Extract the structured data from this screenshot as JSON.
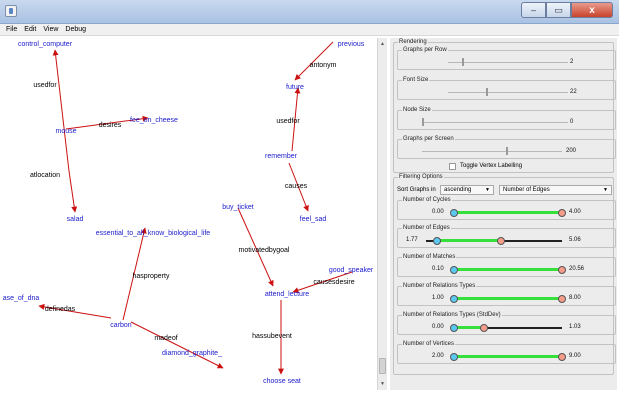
{
  "window": {
    "controls": [
      "–",
      "▭",
      "x"
    ]
  },
  "menu": [
    "File",
    "Edit",
    "View",
    "Debug"
  ],
  "graph": {
    "vertices": [
      {
        "id": "control_computer",
        "label": "control_computer"
      },
      {
        "id": "mouse",
        "label": "mouse"
      },
      {
        "id": "fee_on_cheese",
        "label": "fee_on_cheese"
      },
      {
        "id": "salad",
        "label": "salad"
      },
      {
        "id": "previous",
        "label": "previous"
      },
      {
        "id": "future",
        "label": "future"
      },
      {
        "id": "remember",
        "label": "remember"
      },
      {
        "id": "feel_sad",
        "label": "feel_sad"
      },
      {
        "id": "buy_ticket",
        "label": "buy_ticket"
      },
      {
        "id": "essential",
        "label": "essential_to_all_know_biological_life"
      },
      {
        "id": "good_speaker",
        "label": "good_speaker"
      },
      {
        "id": "attend_lecture",
        "label": "attend_lecture"
      },
      {
        "id": "ase_of_dna",
        "label": "ase_of_dna"
      },
      {
        "id": "carbon",
        "label": "carbon"
      },
      {
        "id": "diamond",
        "label": "diamond_graphite_"
      },
      {
        "id": "choose_seat",
        "label": "choose seat"
      }
    ],
    "edge_labels": [
      {
        "id": "usedfor1",
        "label": "usedfor"
      },
      {
        "id": "desires",
        "label": "desires"
      },
      {
        "id": "atlocation",
        "label": "atlocation"
      },
      {
        "id": "antonym",
        "label": "antonym"
      },
      {
        "id": "usedfor2",
        "label": "usedfor"
      },
      {
        "id": "causes",
        "label": "causes"
      },
      {
        "id": "motivatedbygoal",
        "label": "motivatedbygoal"
      },
      {
        "id": "hasproperty",
        "label": "hasproperty"
      },
      {
        "id": "causesdesire",
        "label": "causesdesire"
      },
      {
        "id": "definedas",
        "label": "definedas"
      },
      {
        "id": "madeof",
        "label": "madeof"
      },
      {
        "id": "hassubevent",
        "label": "hassubevent"
      }
    ],
    "colors": {
      "vertex_text": "#1a1acc",
      "edge_text": "#000000",
      "edge": "#cc1111"
    }
  },
  "rendering": {
    "title": "Rendering",
    "graphs_per_row": {
      "label": "Graphs per Row",
      "value": "2",
      "fraction": 0.12
    },
    "font_size": {
      "label": "Font Size",
      "value": "22",
      "fraction": 0.32
    },
    "node_size": {
      "label": "Node Size",
      "value": "0",
      "fraction": 0.0
    },
    "graphs_per_screen": {
      "label": "Graphs per Screen",
      "value": "200",
      "fraction": 0.6
    },
    "toggle_label": "Toggle Vertex Labelling"
  },
  "filtering": {
    "title": "Filtering Options",
    "sort_label": "Sort Graphs in",
    "order": "ascending",
    "metric": "Number of Edges",
    "ranges": [
      {
        "label": "Number of Cycles",
        "min": "0.00",
        "max": "4.00",
        "lo": 0.0,
        "hi": 1.0
      },
      {
        "label": "Number of Edges",
        "min": "1.77",
        "max": "5.06",
        "lo": 0.08,
        "hi": 0.55
      },
      {
        "label": "Number of Matches",
        "min": "0.10",
        "max": "20.56",
        "lo": 0.0,
        "hi": 1.0
      },
      {
        "label": "Number of Relations Types",
        "min": "1.00",
        "max": "8.00",
        "lo": 0.0,
        "hi": 1.0
      },
      {
        "label": "Number of Relations Types (StdDev)",
        "min": "0.00",
        "max": "1.03",
        "lo": 0.0,
        "hi": 0.28
      },
      {
        "label": "Number of Vertices",
        "min": "2.00",
        "max": "9.00",
        "lo": 0.0,
        "hi": 1.0
      }
    ]
  }
}
